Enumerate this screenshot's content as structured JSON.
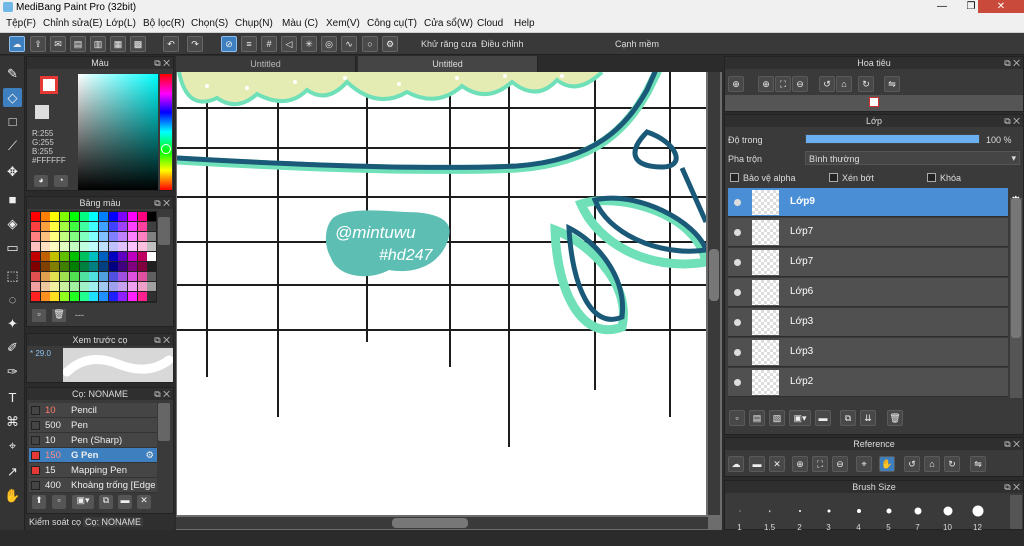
{
  "window": {
    "title": "MediBang Paint Pro (32bit)",
    "btn_min": "—",
    "btn_max": "❐",
    "btn_close": "✕"
  },
  "menu": [
    "Tệp(F)",
    "Chỉnh sửa(E)",
    "Lớp(L)",
    "Bộ lọc(R)",
    "Chọn(S)",
    "Chụp(N)",
    "Màu (C)",
    "Xem(V)",
    "Công cụ(T)",
    "Cửa sổ(W)",
    "Cloud",
    "Help"
  ],
  "toolbar": {
    "antialias_label": "Khử răng cưa",
    "adjust_label": "Điều chỉnh",
    "adjust_value": "12",
    "snap_label": "Cạnh mềm"
  },
  "color_panel": {
    "title": "Màu",
    "r": "R:255",
    "g": "G:255",
    "b": "B:255",
    "hex": "#FFFFFF"
  },
  "swatch_panel": {
    "title": "Bảng màu",
    "more": "---"
  },
  "preview_panel": {
    "title": "Xem trước cọ",
    "size": "29.0"
  },
  "brush_panel": {
    "title": "Cọ: NONAME",
    "brushes": [
      {
        "size": "10",
        "name": "Pencil",
        "color": "#1e1e1e"
      },
      {
        "size": "500",
        "name": "Pen",
        "color": "#1e1e1e"
      },
      {
        "size": "10",
        "name": "Pen (Sharp)",
        "color": "#1e1e1e"
      },
      {
        "size": "150",
        "name": "G Pen",
        "color": "#e53935"
      },
      {
        "size": "15",
        "name": "Mapping Pen",
        "color": "#e53935"
      },
      {
        "size": "400",
        "name": "Khoảng trống [Edge R",
        "color": "#1e1e1e"
      }
    ]
  },
  "bottom_tabs": {
    "tab1": "Kiểm soát cọ",
    "tab2": "Cọ: NONAME"
  },
  "doc_tabs": [
    "Untitled",
    "Untitled"
  ],
  "canvas": {
    "watermark_line1": "@mintuwu",
    "watermark_line2": "#hd247"
  },
  "navigator": {
    "title": "Hoa tiêu"
  },
  "layers": {
    "title": "Lớp",
    "opacity_label": "Độ trong",
    "opacity_value": "100 %",
    "blend_label": "Pha trộn",
    "blend_value": "Bình thường",
    "protect_alpha": "Bảo vệ alpha",
    "clipping": "Xén bớt",
    "lock": "Khóa",
    "items": [
      "Lớp9",
      "Lớp7",
      "Lớp7",
      "Lớp6",
      "Lớp3",
      "Lớp3",
      "Lớp2"
    ]
  },
  "reference": {
    "title": "Reference"
  },
  "brush_size": {
    "title": "Brush Size",
    "sizes": [
      "1",
      "1.5",
      "2",
      "3",
      "4",
      "5",
      "7",
      "10",
      "12"
    ]
  },
  "colors": {
    "accent": "#3e7fbf",
    "teal": "#5fd6b0",
    "navy": "#1a5a78",
    "cream": "#e6edb8"
  }
}
